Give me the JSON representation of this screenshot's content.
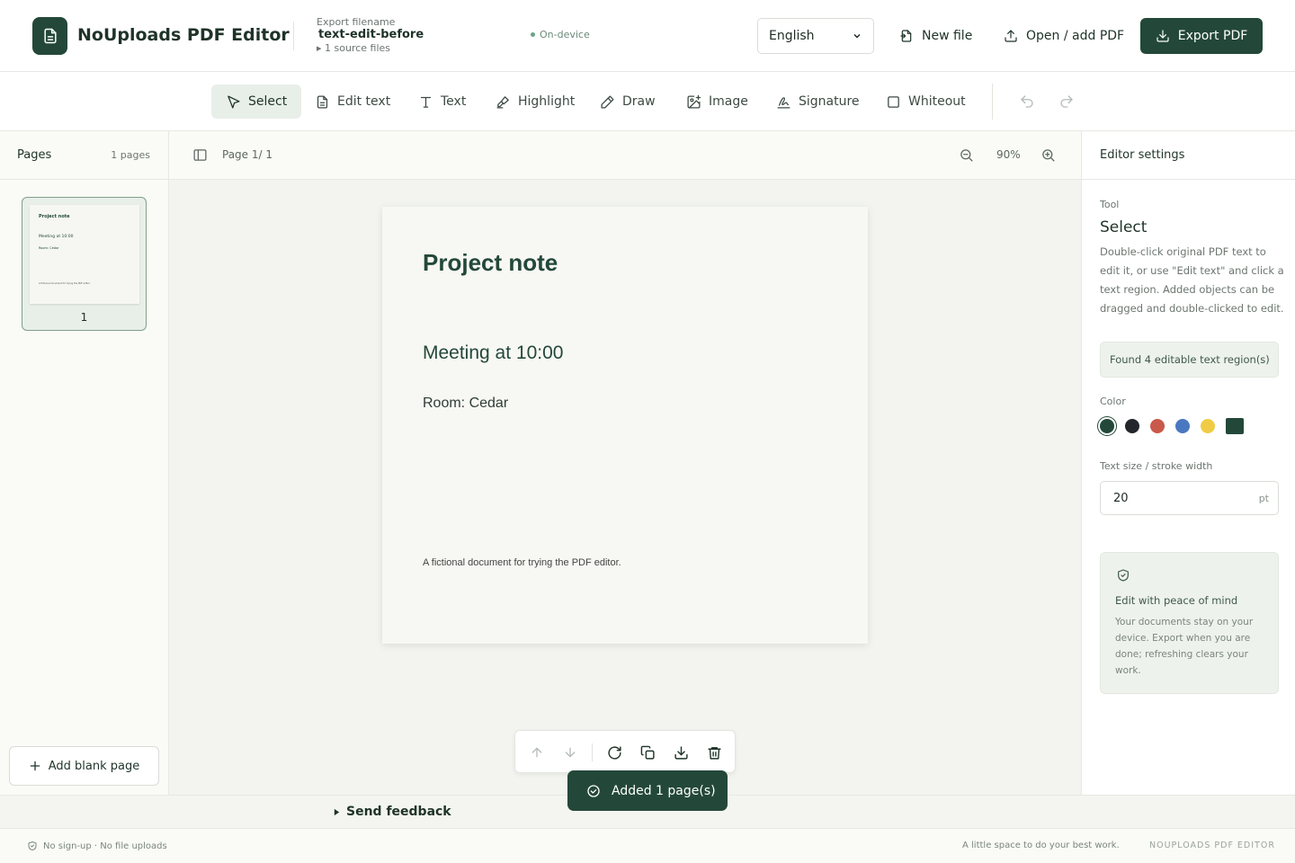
{
  "header": {
    "app_title": "NoUploads PDF Editor",
    "export_filename_label": "Export filename",
    "export_filename_value": "text-edit-before",
    "source_files": "▸ 1 source files",
    "status": "On-device",
    "language": "English",
    "new_file_label": "New file",
    "open_label": "Open / add PDF",
    "export_label": "Export PDF"
  },
  "toolbar": {
    "tools": [
      {
        "label": "Select",
        "icon": "cursor-icon",
        "active": true
      },
      {
        "label": "Edit text",
        "icon": "document-icon"
      },
      {
        "label": "Text",
        "icon": "text-icon"
      },
      {
        "label": "Highlight",
        "icon": "highlighter-icon"
      },
      {
        "label": "Draw",
        "icon": "pencil-icon"
      },
      {
        "label": "Image",
        "icon": "image-icon"
      },
      {
        "label": "Signature",
        "icon": "signature-icon"
      },
      {
        "label": "Whiteout",
        "icon": "square-icon"
      }
    ]
  },
  "sidebar": {
    "title": "Pages",
    "count": "1 pages",
    "thumbnail_number": "1",
    "add_blank_label": "Add blank page"
  },
  "canvas": {
    "page_indicator": "Page 1/ 1",
    "zoom": "90%"
  },
  "document": {
    "title": "Project note",
    "meeting": "Meeting at 10:00",
    "room": "Room: Cedar",
    "footer": "A fictional document for trying the PDF editor."
  },
  "toast": {
    "message": "Added 1 page(s)"
  },
  "settings": {
    "title": "Editor settings",
    "tool_label": "Tool",
    "tool_value": "Select",
    "description": "Double-click original PDF text to edit it, or use \"Edit text\" and click a text region. Added objects can be dragged and double-clicked to edit.",
    "found_regions": "Found 4 editable text region(s)",
    "color_label": "Color",
    "colors": [
      "#23483a",
      "#23262a",
      "#c9594a",
      "#4a78c0",
      "#f0cc45",
      "#23483a"
    ],
    "size_label": "Text size / stroke width",
    "size_value": "20",
    "size_unit": "pt",
    "peace_title": "Edit with peace of mind",
    "peace_text": "Your documents stay on your device. Export when you are done; refreshing clears your work."
  },
  "feedback": {
    "label": "Send feedback"
  },
  "footer": {
    "privacy": "No sign-up · No file uploads",
    "tagline": "A little space to do your best work.",
    "brand": "NOUPLOADS PDF EDITOR"
  },
  "colors": {
    "accent": "#23483a",
    "background": "#fafbf6"
  }
}
